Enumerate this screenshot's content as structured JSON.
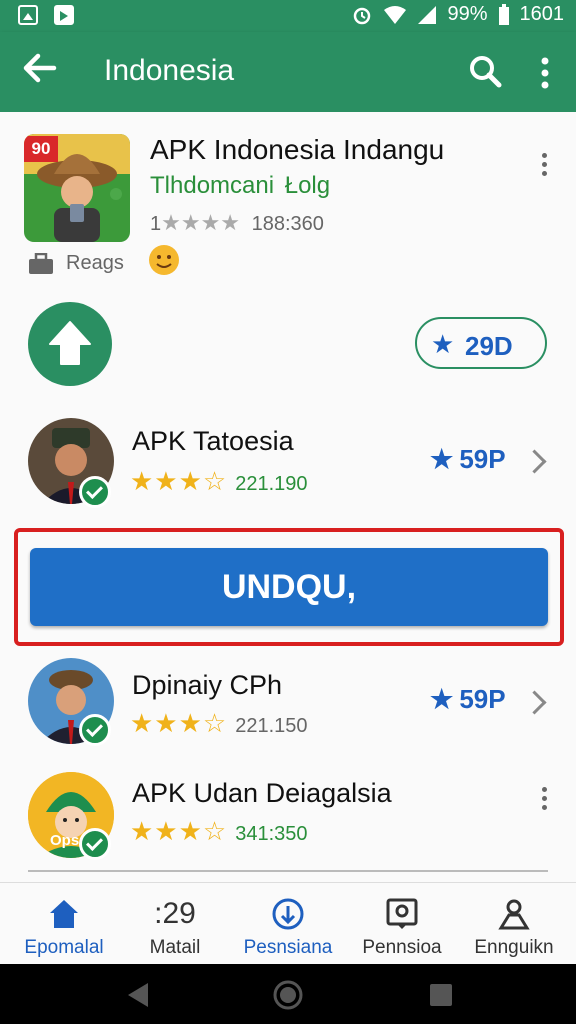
{
  "status_bar": {
    "battery": "99%",
    "time": "1601"
  },
  "app_bar": {
    "title": "Indonesia"
  },
  "featured": {
    "thumb_badge": "90",
    "title": "APK Indonesia Indangu",
    "subtitle": "Tlhdomcani",
    "subtitle_tag": "Łolg",
    "rating_prefix": "1",
    "rating_stars": 1,
    "rating_count": "188:360",
    "meta_label": "Reags",
    "install_count": "29D"
  },
  "list": [
    {
      "title": "APK Tatoesia",
      "rating": 3.5,
      "count": "221.190",
      "rank": "59P"
    },
    {
      "title": "Dpinaiy CPh",
      "rating": 3.5,
      "count": "221.150",
      "rank": "59P"
    },
    {
      "title": "APK Udan Deiagalsia",
      "rating": 3.5,
      "count": "341:350",
      "avatar_text": "Ops"
    }
  ],
  "download_button": {
    "label": "UNDQU,"
  },
  "bottom_nav": {
    "items": [
      {
        "label": "Epomalal",
        "icon": "home-icon",
        "active": true
      },
      {
        "label": "Matail",
        "icon": "29-icon",
        "icon_text": ":29",
        "active": false
      },
      {
        "label": "Pesnsiana",
        "icon": "circle-plus-icon",
        "active": true
      },
      {
        "label": "Pennsioa",
        "icon": "profile-icon",
        "active": false
      },
      {
        "label": "Ennguikn",
        "icon": "person-icon",
        "active": false
      }
    ]
  },
  "colors": {
    "primary": "#2a8f62",
    "accent_blue": "#1f6fc7",
    "highlight_red": "#d81f1f",
    "star_gold": "#f0b21a"
  }
}
